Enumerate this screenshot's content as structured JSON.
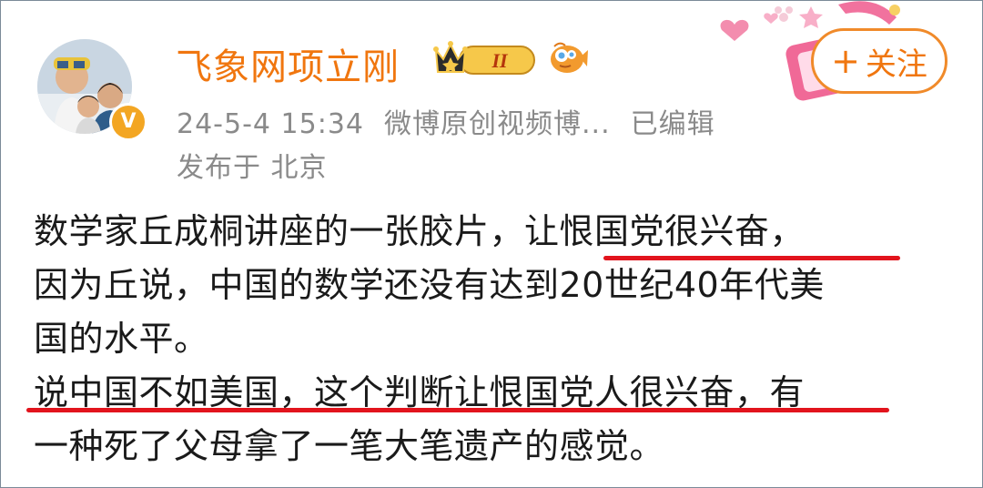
{
  "header": {
    "username": "飞象网项立刚",
    "level_badge": "II",
    "verified_badge": "V",
    "timestamp": "24-5-4 15:34",
    "source": "微博原创视频博...",
    "edited": "已编辑",
    "location": "发布于 北京",
    "follow_label": "关注",
    "follow_plus": "+"
  },
  "post": {
    "line1_plain": "数学家丘成桐讲座的一张胶片，",
    "line1_highlight": "让恨国党很兴奋",
    "line1_tail": "，",
    "line2": "因为丘说，中国的数学还没有达到20世纪40年代美",
    "line3": "国的水平。",
    "line4_highlight": "说中国不如美国，这个判断让恨国党人很兴奋，",
    "line4_tail": "有",
    "line5": "一种死了父母拿了一笔大笔遗产的感觉。"
  },
  "colors": {
    "username": "#f0760f",
    "meta": "#8a8a8a",
    "underline": "#e2141d",
    "follow_border": "#f08a2a"
  }
}
